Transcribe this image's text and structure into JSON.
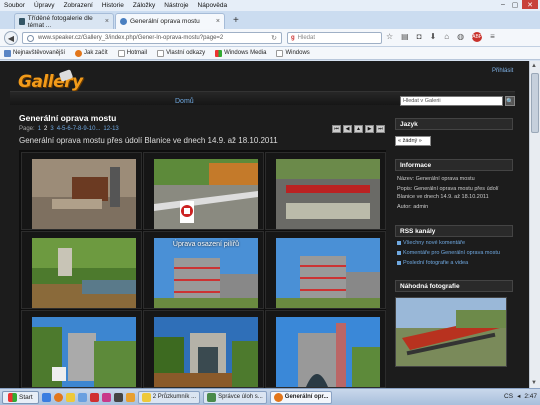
{
  "menubar": {
    "items": [
      "Soubor",
      "Úpravy",
      "Zobrazení",
      "Historie",
      "Záložky",
      "Nástroje",
      "Nápověda"
    ]
  },
  "tabs": [
    {
      "label": "Tříděné fotogalerie dle témat ..."
    },
    {
      "label": "Generální oprava mostu"
    }
  ],
  "navbar": {
    "url": "www.speaker.cz/Gallery_3/index.php/Gener-ln-oprava-mostu?page=2",
    "search_placeholder": "Hledat"
  },
  "bookmarks": [
    {
      "label": "Nejnavštěvovanější"
    },
    {
      "label": "Jak začít"
    },
    {
      "label": "Hotmail"
    },
    {
      "label": "Vlastní odkazy"
    },
    {
      "label": "Windows Media"
    },
    {
      "label": "Windows"
    }
  ],
  "gallery": {
    "logo": "Gallery",
    "login": "Přihlásit",
    "home": "Domů",
    "search_placeholder": "Hledat v Galerii",
    "title": "Generální oprava mostu",
    "pager": {
      "label": "Page:",
      "pages": [
        "1",
        "2",
        "3",
        "4-5-6-7-8-9-10...",
        "12-13"
      ],
      "current": "2"
    },
    "description": "Generální oprava mostu přes údolí Blanice ve dnech 14.9. až 18.10.2011",
    "photo_caption": "Úprava osazení pilířů"
  },
  "sidebar": {
    "language_head": "Jazyk",
    "language_value": "« žádný »",
    "info_head": "Informace",
    "info_name": "Název: Generální oprava mostu",
    "info_desc": "Popis: Generální oprava mostu přes údolí Blanice ve dnech 14.9. až 18.10.2011",
    "info_author": "Autor: admin",
    "rss_head": "RSS kanály",
    "rss_items": [
      "Všechny nové komentáře",
      "Komentáře pro Generální oprava mostu",
      "Poslední fotografie a videa"
    ],
    "random_head": "Náhodná fotografie"
  },
  "taskbar": {
    "start": "Start",
    "tasks": [
      "2 Průzkumník ...",
      "Správce úloh s...",
      "Generální opr..."
    ],
    "time": "2:47",
    "lang": "CS"
  }
}
